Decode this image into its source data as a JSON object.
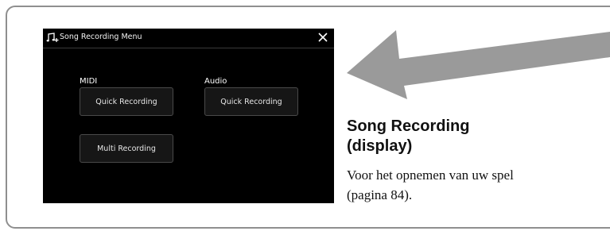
{
  "dialog": {
    "title": "Song Recording Menu",
    "title_icon": "song-record-icon",
    "close_icon": "close-icon",
    "midi": {
      "label": "MIDI",
      "quick_label": "Quick Recording",
      "multi_label": "Multi Recording"
    },
    "audio": {
      "label": "Audio",
      "quick_label": "Quick Recording"
    }
  },
  "callout": {
    "title_line1": "Song Recording",
    "title_line2": "(display)",
    "body_line1": "Voor het opnemen van uw spel",
    "body_line2": "(pagina 84)."
  },
  "colors": {
    "screen_bg": "#000000",
    "button_bg": "#161616",
    "arrow": "#9a9a9a",
    "frame_border": "#8f8f8f"
  }
}
